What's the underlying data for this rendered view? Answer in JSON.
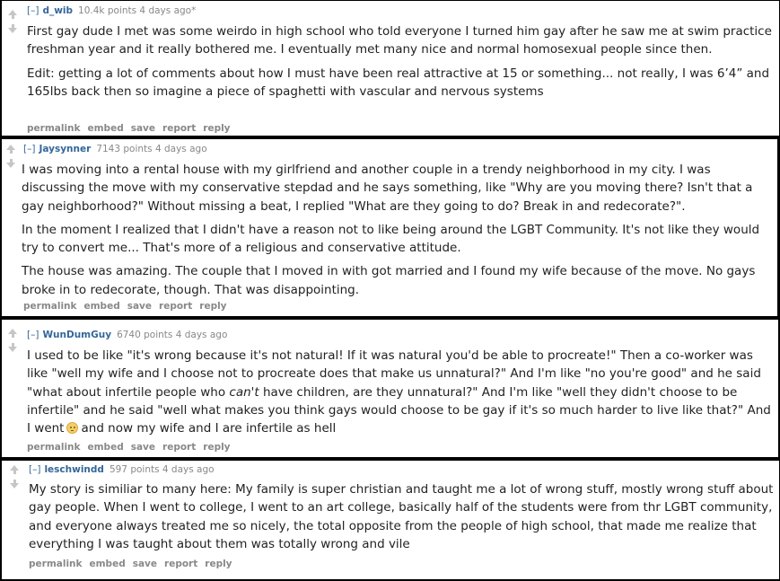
{
  "comments": [
    {
      "toggle": "[–]",
      "author": "d_wib",
      "points_time": "10.4k points 4 days ago*",
      "paragraphs": [
        "First gay dude I met was some weirdo in high school who told everyone I turned him gay after he saw me at swim practice freshman year and it really bothered me. I eventually met many nice and normal homosexual people since then.",
        "Edit: getting a lot of comments about how I must have been real attractive at 15 or something... not really, I was 6’4” and 165lbs back then so imagine a piece of spaghetti with vascular and nervous systems"
      ]
    },
    {
      "toggle": "[–]",
      "author": "Jaysynner",
      "points_time": "7143 points 4 days ago",
      "paragraphs": [
        "I was moving into a rental house with my girlfriend and another couple in a trendy neighborhood in my city. I was discussing the move with my conservative stepdad and he says something, like \"Why are you moving there? Isn't that a gay neighborhood?\" Without missing a beat, I replied \"What are they going to do? Break in and redecorate?\".",
        "In the moment I realized that I didn't have a reason not to like being around the LGBT Community. It's not like they would try to convert me... That's more of a religious and conservative attitude.",
        "The house was amazing. The couple that I moved in with got married and I found my wife because of the move. No gays broke in to redecorate, though. That was disappointing."
      ]
    },
    {
      "toggle": "[–]",
      "author": "WunDumGuy",
      "points_time": "6740 points 4 days ago",
      "text_a": "I used to be like \"it's wrong because it's not natural! If it was natural you'd be able to procreate!\" Then a co-worker was like \"well my wife and I choose not to procreate does that make us unnatural?\" And I'm like \"no you're good\" and he said \"what about infertile people who ",
      "text_em": "can't",
      "text_b": " have children, are they unnatural?\" And I'm like \"well they didn't choose to be infertile\" and he said \"well what makes you think gays would choose to be gay if it's so much harder to live like that?\" And I went",
      "emoji_icon": "thinking-face",
      "text_c": "and now my wife and I are infertile as hell"
    },
    {
      "toggle": "[–]",
      "author": "leschwindd",
      "points_time": "597 points 4 days ago",
      "paragraphs": [
        "My story is similiar to many here: My family is super christian and taught me a lot of wrong stuff, mostly wrong stuff about gay people. When I went to college, I went to an art college, basically half of the students were from thr LGBT community, and everyone always treated me so nicely, the total opposite from the people of high school, that made me realize that everything I was taught about them was totally wrong and vile"
      ]
    }
  ],
  "buttons": {
    "permalink": "permalink",
    "embed": "embed",
    "save": "save",
    "report": "report",
    "reply": "reply"
  },
  "colors": {
    "background": "#000000",
    "panel": "#ffffff",
    "author_link": "#336699",
    "meta_text": "#888888",
    "body_text": "#222222",
    "vote_arrow": "#c6c6c6"
  }
}
